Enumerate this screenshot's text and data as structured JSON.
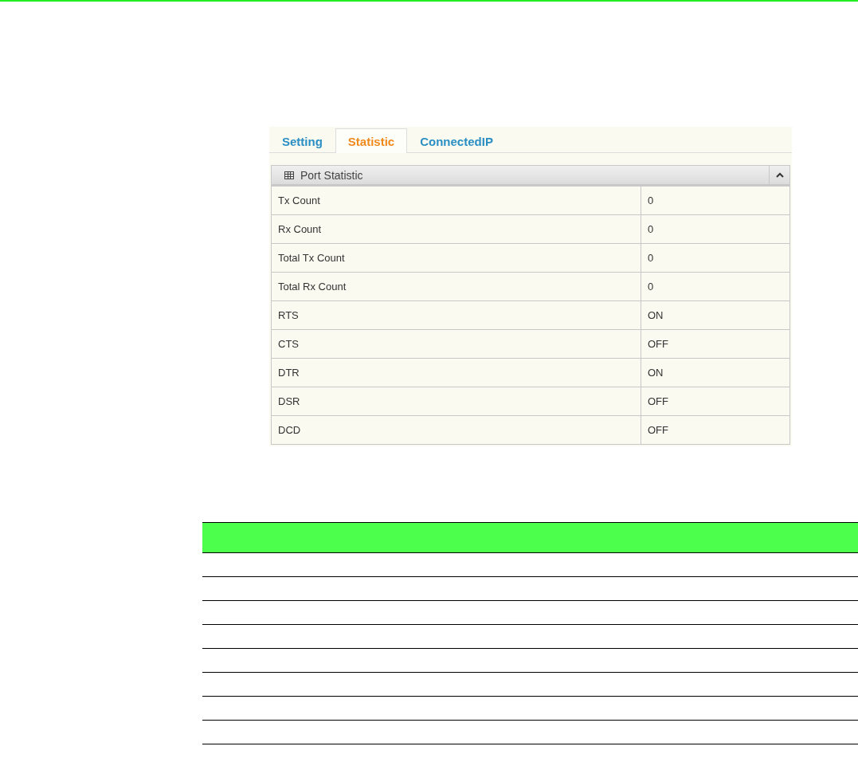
{
  "tabs": [
    {
      "label": "Setting",
      "selected": false
    },
    {
      "label": "Statistic",
      "selected": true
    },
    {
      "label": "ConnectedIP",
      "selected": false
    }
  ],
  "panel": {
    "title": "Port Statistic",
    "expanded": true,
    "rows": [
      {
        "label": "Tx Count",
        "value": "0"
      },
      {
        "label": "Rx Count",
        "value": "0"
      },
      {
        "label": "Total Tx Count",
        "value": "0"
      },
      {
        "label": "Total Rx Count",
        "value": "0"
      },
      {
        "label": "RTS",
        "value": "ON"
      },
      {
        "label": "CTS",
        "value": "OFF"
      },
      {
        "label": "DTR",
        "value": "ON"
      },
      {
        "label": "DSR",
        "value": "OFF"
      },
      {
        "label": "DCD",
        "value": "OFF"
      }
    ]
  }
}
